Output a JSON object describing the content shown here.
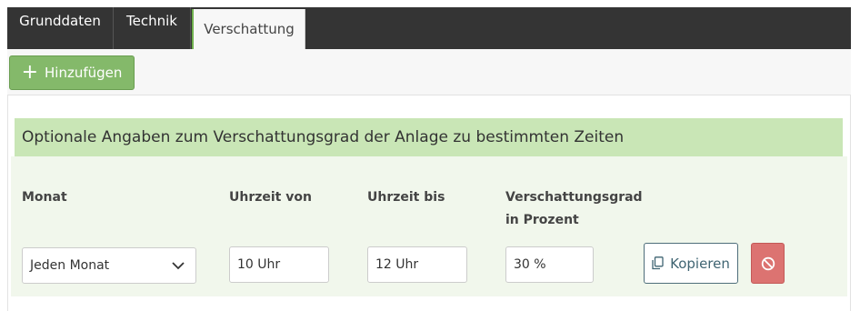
{
  "tabs": [
    {
      "label": "Grunddaten",
      "active": false
    },
    {
      "label": "Technik",
      "active": false
    },
    {
      "label": "Verschattung",
      "active": true
    }
  ],
  "toolbar": {
    "add_label": "Hinzufügen",
    "add_icon": "plus-icon"
  },
  "section": {
    "heading": "Optionale Angaben zum Verschattungsgrad der Anlage zu bestimmten Zeiten"
  },
  "form": {
    "labels": {
      "month": "Monat",
      "time_from": "Uhrzeit von",
      "time_to": "Uhrzeit bis",
      "shading_line1": "Verschattungsgrad",
      "shading_line2": "in Prozent"
    },
    "row": {
      "month": "Jeden Monat",
      "time_from": "10 Uhr",
      "time_to": "12 Uhr",
      "shading": "30 %"
    },
    "copy_label": "Kopieren",
    "copy_icon": "copy-icon",
    "delete_icon": "ban-icon"
  },
  "colors": {
    "tabbar": "#343434",
    "accent_green": "#84b96a",
    "heading_bg": "#c9e6b6",
    "form_bg": "#f1f7ec",
    "delete_red": "#dc7371",
    "copy_border": "#4e6e7a"
  }
}
